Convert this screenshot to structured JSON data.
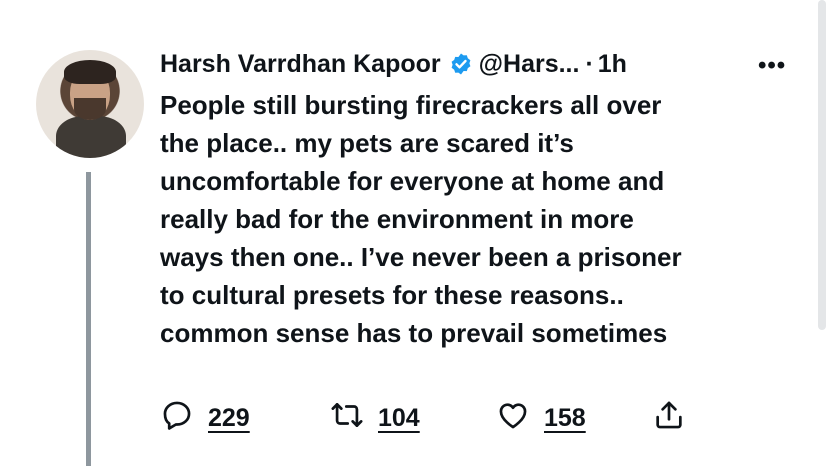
{
  "tweet": {
    "author_name": "Harsh Varrdhan Kapoor",
    "handle": "@Hars...",
    "separator": "·",
    "time": "1h",
    "more_label": "•••",
    "text_lines": [
      "People still bursting firecrackers all over",
      "the place.. my pets are scared it’s",
      "uncomfortable for everyone at home and",
      "really bad for the environment in more",
      "ways then one.. I’ve never been a prisoner",
      "to cultural presets for these reasons..",
      "common sense has to prevail sometimes"
    ],
    "actions": {
      "replies": "229",
      "retweets": "104",
      "likes": "158"
    }
  },
  "icons": {
    "verified": "verified-badge-icon",
    "reply": "reply-bubble-icon",
    "retweet": "retweet-icon",
    "like": "heart-icon",
    "share": "share-icon",
    "more": "more-dots-icon"
  },
  "colors": {
    "text": "#0f1419",
    "verified": "#1d9bf0",
    "thread_line": "#8e979e"
  }
}
